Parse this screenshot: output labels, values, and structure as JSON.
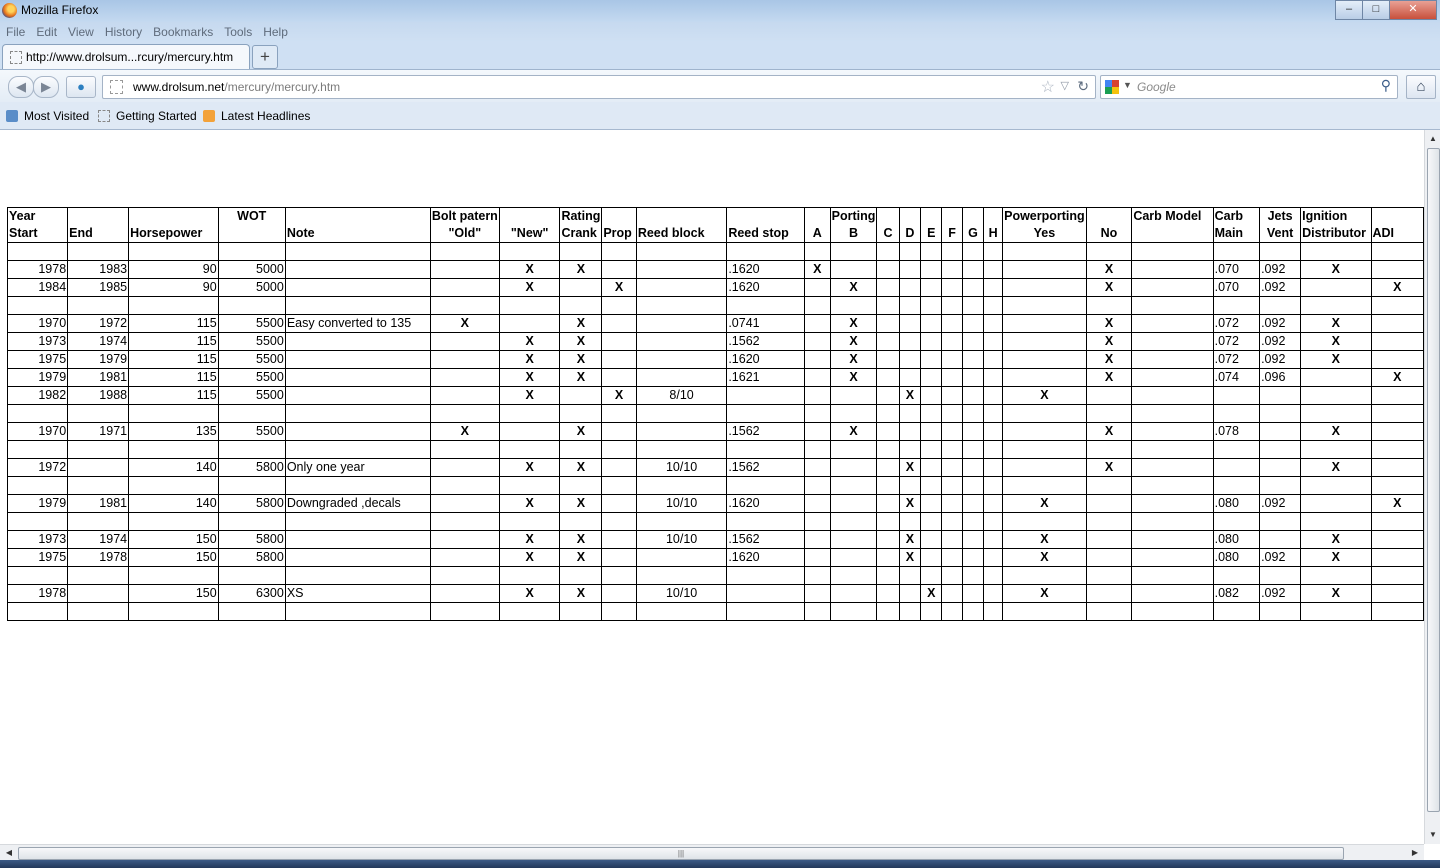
{
  "window": {
    "title": "Mozilla Firefox",
    "buttons": [
      "–",
      "□",
      "✕"
    ]
  },
  "menu": [
    "File",
    "Edit",
    "View",
    "History",
    "Bookmarks",
    "Tools",
    "Help"
  ],
  "tab": {
    "title": "http://www.drolsum...rcury/mercury.htm",
    "new_tab": "+"
  },
  "nav": {
    "url_host": "www.drolsum.net",
    "url_path": "/mercury/mercury.htm",
    "search_placeholder": "Google"
  },
  "bookmarks": [
    "Most Visited",
    "Getting Started",
    "Latest Headlines"
  ],
  "table": {
    "header1": [
      "Year",
      "",
      "",
      "WOT",
      "",
      "Bolt patern",
      "",
      "Rating",
      "",
      "",
      "",
      "",
      "Porting",
      "",
      "",
      "",
      "",
      "",
      "",
      "Powerporting",
      "",
      "Carb Model",
      "Carb",
      "Jets",
      "Ignition",
      ""
    ],
    "header2": [
      "Start",
      "End",
      "Horsepower",
      "",
      "Note",
      "\"Old\"",
      "\"New\"",
      "Crank",
      "Prop",
      "Reed block",
      "Reed stop",
      "A",
      "B",
      "C",
      "D",
      "E",
      "F",
      "G",
      "H",
      "Yes",
      "No",
      "",
      "Main",
      "Vent",
      "Distributor",
      "ADI"
    ],
    "rows": [
      [],
      [
        "1978",
        "1983",
        "90",
        "5000",
        "",
        "",
        "X",
        "X",
        "",
        "",
        ".1620",
        "X",
        "",
        "",
        "",
        "",
        "",
        "",
        "",
        "",
        "X",
        "",
        ".070",
        ".092",
        "X",
        ""
      ],
      [
        "1984",
        "1985",
        "90",
        "5000",
        "",
        "",
        "X",
        "",
        "X",
        "",
        ".1620",
        "",
        "X",
        "",
        "",
        "",
        "",
        "",
        "",
        "",
        "X",
        "",
        ".070",
        ".092",
        "",
        "X"
      ],
      [],
      [
        "1970",
        "1972",
        "115",
        "5500",
        "Easy converted to 135",
        "X",
        "",
        "X",
        "",
        "",
        ".0741",
        "",
        "X",
        "",
        "",
        "",
        "",
        "",
        "",
        "",
        "X",
        "",
        ".072",
        ".092",
        "X",
        ""
      ],
      [
        "1973",
        "1974",
        "115",
        "5500",
        "",
        "",
        "X",
        "X",
        "",
        "",
        ".1562",
        "",
        "X",
        "",
        "",
        "",
        "",
        "",
        "",
        "",
        "X",
        "",
        ".072",
        ".092",
        "X",
        ""
      ],
      [
        "1975",
        "1979",
        "115",
        "5500",
        "",
        "",
        "X",
        "X",
        "",
        "",
        ".1620",
        "",
        "X",
        "",
        "",
        "",
        "",
        "",
        "",
        "",
        "X",
        "",
        ".072",
        ".092",
        "X",
        ""
      ],
      [
        "1979",
        "1981",
        "115",
        "5500",
        "",
        "",
        "X",
        "X",
        "",
        "",
        ".1621",
        "",
        "X",
        "",
        "",
        "",
        "",
        "",
        "",
        "",
        "X",
        "",
        ".074",
        ".096",
        "",
        "X"
      ],
      [
        "1982",
        "1988",
        "115",
        "5500",
        "",
        "",
        "X",
        "",
        "X",
        "8/10",
        "",
        "",
        "",
        "",
        "X",
        "",
        "",
        "",
        "",
        "X",
        "",
        "",
        "",
        "",
        "",
        ""
      ],
      [],
      [
        "1970",
        "1971",
        "135",
        "5500",
        "",
        "X",
        "",
        "X",
        "",
        "",
        ".1562",
        "",
        "X",
        "",
        "",
        "",
        "",
        "",
        "",
        "",
        "X",
        "",
        ".078",
        "",
        "X",
        ""
      ],
      [],
      [
        "1972",
        "",
        "140",
        "5800",
        "Only one year",
        "",
        "X",
        "X",
        "",
        "10/10",
        ".1562",
        "",
        "",
        "",
        "X",
        "",
        "",
        "",
        "",
        "",
        "X",
        "",
        "",
        "",
        "X",
        ""
      ],
      [],
      [
        "1979",
        "1981",
        "140",
        "5800",
        "Downgraded ,decals",
        "",
        "X",
        "X",
        "",
        "10/10",
        ".1620",
        "",
        "",
        "",
        "X",
        "",
        "",
        "",
        "",
        "X",
        "",
        "",
        ".080",
        ".092",
        "",
        "X"
      ],
      [],
      [
        "1973",
        "1974",
        "150",
        "5800",
        "",
        "",
        "X",
        "X",
        "",
        "10/10",
        ".1562",
        "",
        "",
        "",
        "X",
        "",
        "",
        "",
        "",
        "X",
        "",
        "",
        ".080",
        "",
        "X",
        ""
      ],
      [
        "1975",
        "1978",
        "150",
        "5800",
        "",
        "",
        "X",
        "X",
        "",
        "",
        ".1620",
        "",
        "",
        "",
        "X",
        "",
        "",
        "",
        "",
        "X",
        "",
        "",
        ".080",
        ".092",
        "X",
        ""
      ],
      [],
      [
        "1978",
        "",
        "150",
        "6300",
        "XS",
        "",
        "X",
        "X",
        "",
        "10/10",
        "",
        "",
        "",
        "",
        "",
        "X",
        "",
        "",
        "",
        "X",
        "",
        "",
        ".082",
        ".092",
        "X",
        ""
      ],
      []
    ]
  }
}
